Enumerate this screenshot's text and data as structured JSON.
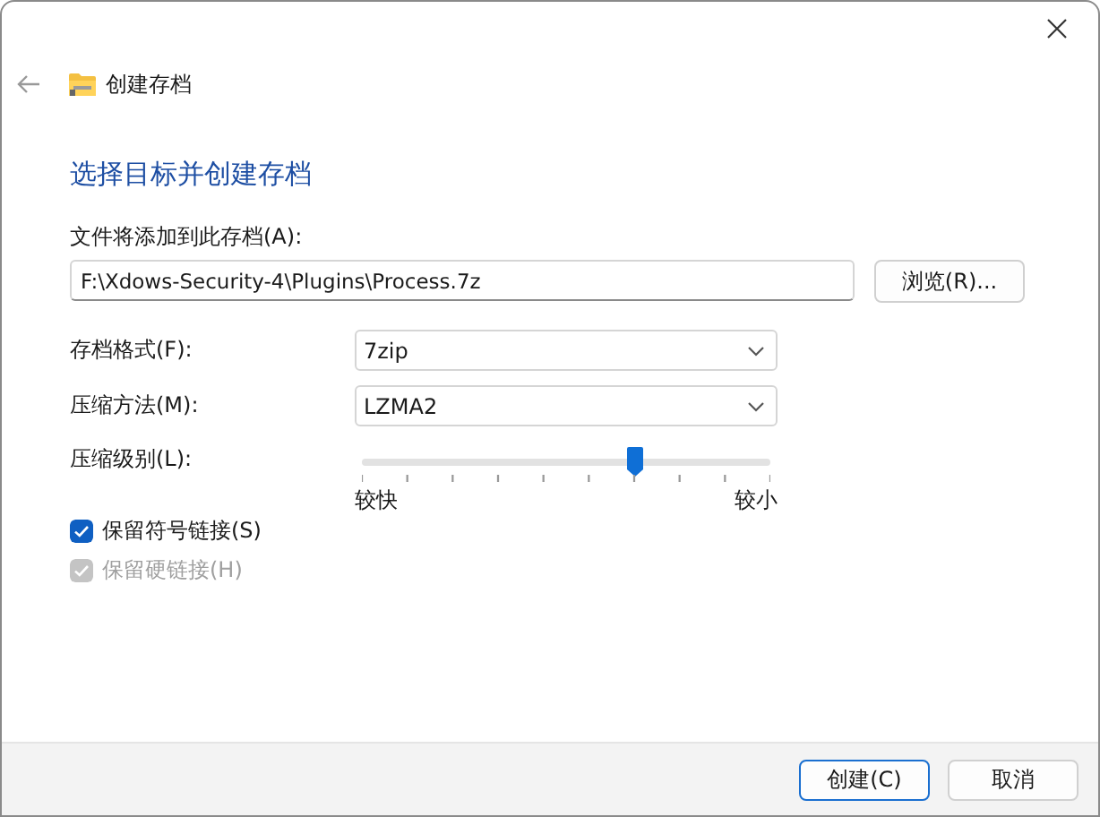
{
  "window": {
    "title": "创建存档"
  },
  "heading": "选择目标并创建存档",
  "archive_path": {
    "label": "文件将添加到此存档(A):",
    "value": "F:\\Xdows-Security-4\\Plugins\\Process.7z",
    "browse_button": "浏览(R)..."
  },
  "options": [
    {
      "kind": "dropdown",
      "label": "存档格式(F):",
      "value": "7zip"
    },
    {
      "kind": "dropdown",
      "label": "压缩方法(M):",
      "value": "LZMA2"
    },
    {
      "kind": "slider",
      "label": "压缩级别(L):",
      "level": 0.667,
      "min_label": "较快",
      "max_label": "较小"
    }
  ],
  "checkboxes": [
    {
      "label": "保留符号链接(S)",
      "checked": true,
      "disabled": false
    },
    {
      "label": "保留硬链接(H)",
      "checked": true,
      "disabled": true
    }
  ],
  "buttons": [
    {
      "label": "创建(C)",
      "default": true
    },
    {
      "label": "取消",
      "default": false
    }
  ]
}
